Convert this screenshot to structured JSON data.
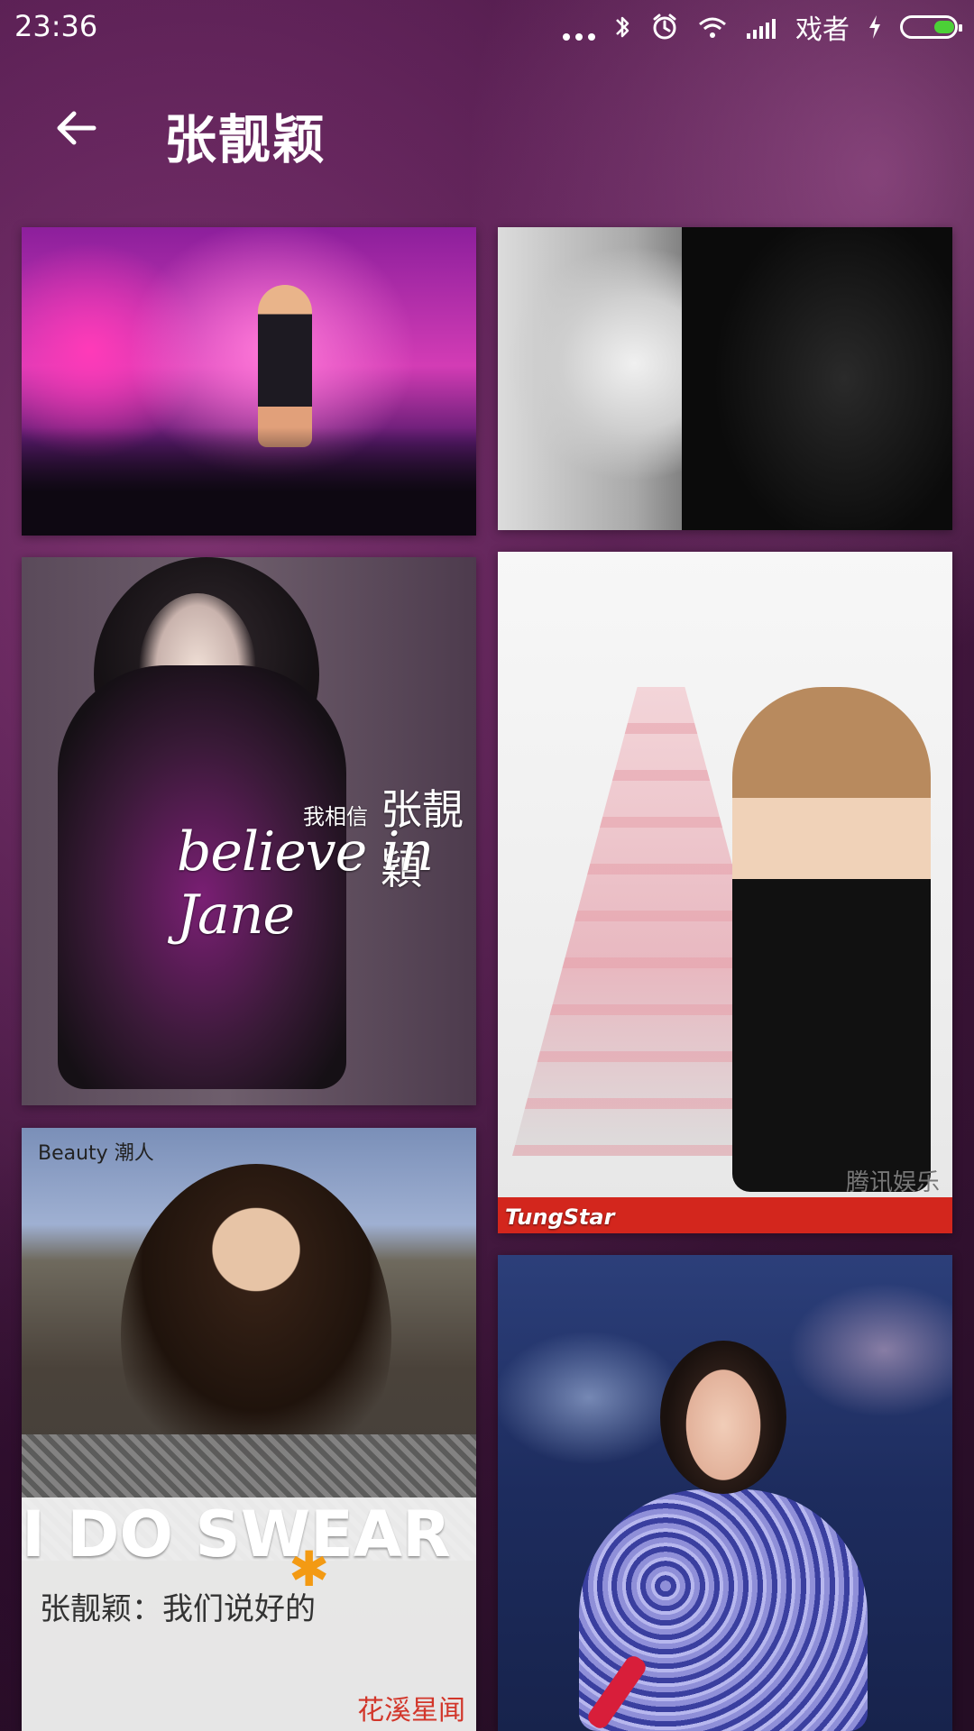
{
  "status_bar": {
    "time": "23:36",
    "carrier": "戏者",
    "battery_level": 0.4,
    "icons": [
      "more-dots-icon",
      "bluetooth-icon",
      "alarm-icon",
      "wifi-icon",
      "signal-icon",
      "charging-icon",
      "battery-icon"
    ]
  },
  "app_bar": {
    "title": "张靓颖",
    "back_icon": "back-arrow-icon"
  },
  "grid": {
    "tiles": [
      {
        "id": "photo-1",
        "desc": "concert stage photo"
      },
      {
        "id": "photo-2",
        "desc": "black and white portrait"
      },
      {
        "id": "photo-3",
        "cover_cn": "我相信",
        "cover_name": "张靚穎",
        "cover_en": "believe in Jane"
      },
      {
        "id": "photo-4",
        "watermark_left": "TungStar",
        "watermark_right": "腾讯娱乐"
      },
      {
        "id": "photo-5",
        "beauty": "Beauty 潮人",
        "headline": "I DO SWEAR",
        "subtitle": "张靓颖：我们说好的",
        "magazine": "花溪星闻"
      },
      {
        "id": "photo-6",
        "desc": "performer in sequin dress"
      }
    ]
  },
  "colors": {
    "background": "#5e2558",
    "accent": "#4cd037"
  }
}
